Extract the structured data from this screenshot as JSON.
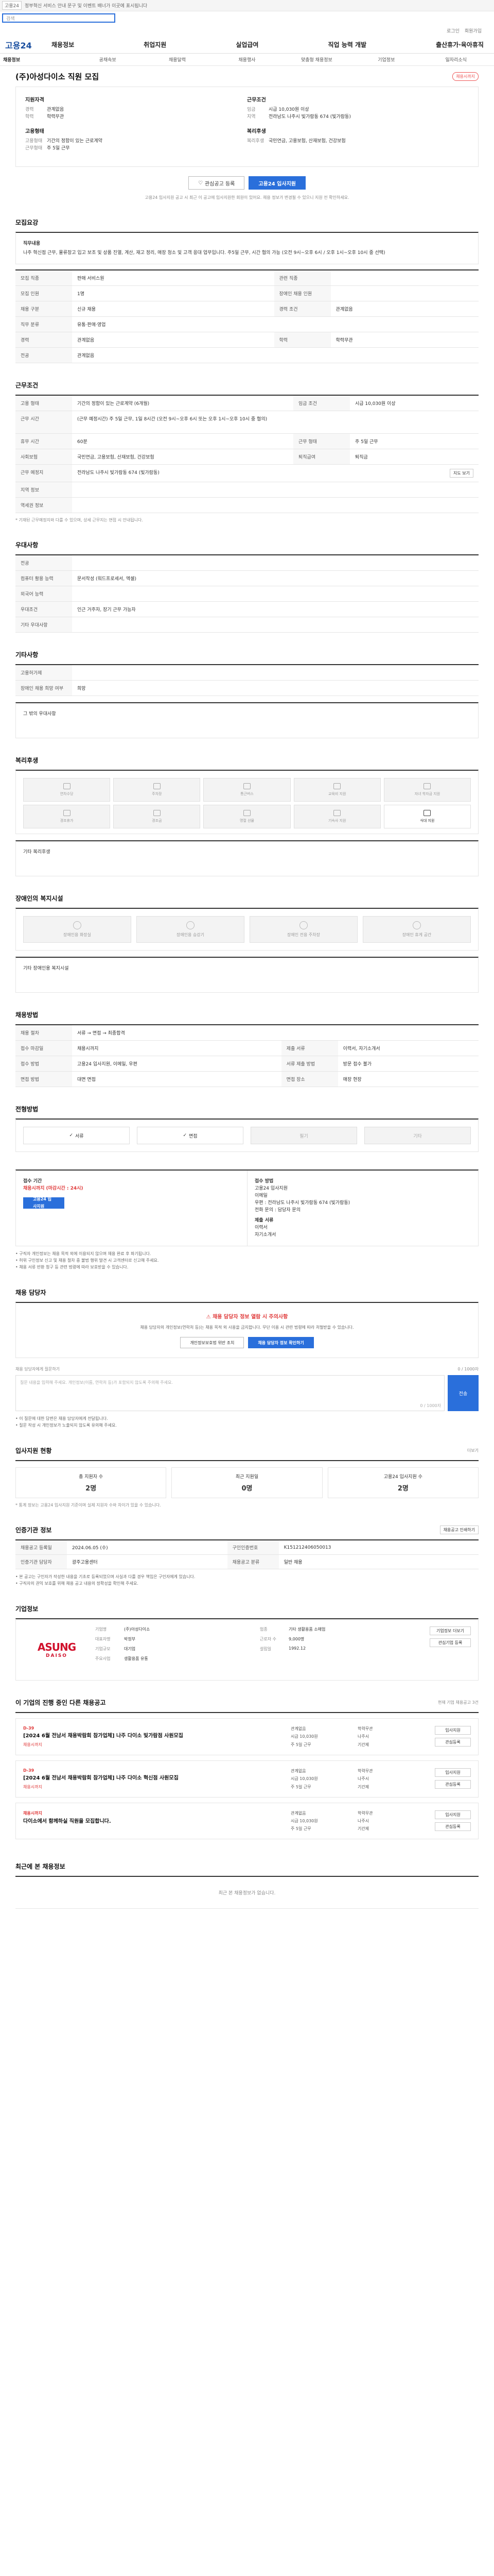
{
  "topbar": {
    "site_chip": "고용24",
    "notice": "정부혁신 서비스 안내 문구 및 이벤트 배너가 이곳에 표시됩니다"
  },
  "search": {
    "placeholder": "검색"
  },
  "util": {
    "login": "로그인",
    "join": "회원가입"
  },
  "gnb": {
    "logo": "고용24",
    "menu": [
      "채용정보",
      "취업지원",
      "실업급여",
      "직업 능력 개발",
      "출산휴가·육아휴직"
    ]
  },
  "lnb": [
    "채용정보",
    "공채속보",
    "채용달력",
    "채용행사",
    "맞춤형 채용정보",
    "기업정보",
    "일자리소식"
  ],
  "title": "(주)아성다이소 직원 모집",
  "title_badge": "채용시까지",
  "summary": {
    "left_title": "지원자격",
    "left_rows": [
      {
        "k": "경력",
        "v": "관계없음"
      },
      {
        "k": "학력",
        "v": "학력무관"
      }
    ],
    "right_title": "근무조건",
    "right_rows": [
      {
        "k": "임금",
        "v": "시급 10,030원 이상"
      },
      {
        "k": "지역",
        "v": "전라남도 나주시 빛가람동 674 (빛가람동)"
      }
    ],
    "left2_title": "고용형태",
    "left2_rows": [
      {
        "k": "고용형태",
        "v": "기간의 정함이 있는 근로계약"
      },
      {
        "k": "근무형태",
        "v": "주 5일 근무"
      }
    ],
    "right2_title": "복리후생",
    "right2_rows": [
      {
        "k": "복리후생",
        "v": "국민연금, 고용보험, 산재보험, 건강보험"
      }
    ]
  },
  "actions": {
    "interest": "관심공고 등록",
    "apply": "고용24 입사지원",
    "note": "고용24 입사지원 공고 시 최근 이 공고에 입사지원한 회원이 있어요. 채용 정보가 변경될 수 있으니 지원 전 확인하세요."
  },
  "recruit": {
    "title": "모집요강",
    "duty_label": "직무내용",
    "duty_text": "나주 혁신점 근무, 물류창고 입고 보조 및 상품 진열, 계산, 재고 정리, 매장 청소 및 고객 응대 업무입니다. 주5일 근무, 시간 협의 가능 (오전 9시~오후 6시 / 오후 1시~오후 10시 중 선택)",
    "rows": [
      {
        "k": "모집 직종",
        "v": "판매 서비스원",
        "k2": "관련 직종",
        "v2": ""
      },
      {
        "k": "모집 인원",
        "v": "1명",
        "k2": "장애인 채용 인원",
        "v2": ""
      },
      {
        "k": "채용 구분",
        "v": "신규 채용",
        "k2": "경력 조건",
        "v2": "관계없음"
      },
      {
        "k": "직무 분류",
        "v": "유통·판매·영업",
        "k2": "",
        "v2": ""
      },
      {
        "k": "경력",
        "v": "관계없음",
        "k2": "학력",
        "v2": "학력무관"
      },
      {
        "k": "전공",
        "v": "관계없음",
        "k2": "",
        "v2": ""
      }
    ]
  },
  "work": {
    "title": "근무조건",
    "rows": [
      {
        "k": "고용 형태",
        "v": "기간의 정함이 있는 근로계약 (6개월)",
        "k2": "임금 조건",
        "v2": "시급 10,030원 이상"
      },
      {
        "k": "근무 시간",
        "v": "(근무 예정시간) 주 5일 근무, 1일 8시간 (오전 9시~오후 6시 또는 오후 1시~오후 10시 중 협의)",
        "k2": "",
        "v2": ""
      },
      {
        "k": "휴무 시간",
        "v": "60분",
        "k2": "근무 형태",
        "v2": "주 5일 근무"
      },
      {
        "k": "사회보험",
        "v": "국민연금, 고용보험, 산재보험, 건강보험",
        "k2": "퇴직급여",
        "v2": "퇴직금"
      },
      {
        "k": "근무 예정지",
        "v": "전라남도 나주시 빛가람동 674 (빛가람동)",
        "k2": "",
        "v2": ""
      },
      {
        "k": "지역 정보",
        "v": "",
        "k2": "",
        "v2": ""
      },
      {
        "k": "역세권 정보",
        "v": "",
        "k2": "",
        "v2": ""
      }
    ],
    "map_button": "지도 보기",
    "note": "* 기재된 근무예정지와 다를 수 있으며, 상세 근무지는 면접 시 안내됩니다."
  },
  "prefer": {
    "title": "우대사항",
    "rows": [
      {
        "k": "전공",
        "v": ""
      },
      {
        "k": "컴퓨터 활용 능력",
        "v": "문서작성 (워드프로세서, 엑셀)"
      },
      {
        "k": "외국어 능력",
        "v": ""
      },
      {
        "k": "우대조건",
        "v": "인근 거주자, 장기 근무 가능자"
      },
      {
        "k": "기타 우대사항",
        "v": ""
      }
    ]
  },
  "etc": {
    "title": "기타사항",
    "rows": [
      {
        "k": "고용허가제",
        "v": ""
      },
      {
        "k": "장애인 채용 희망 여부",
        "v": "희망"
      }
    ]
  },
  "etc_text": {
    "label": "그 밖의 우대사항",
    "value": ""
  },
  "welfare": {
    "title": "복리후생",
    "items": [
      {
        "label": "연차수당",
        "on": false
      },
      {
        "label": "주차장",
        "on": false
      },
      {
        "label": "통근버스",
        "on": false
      },
      {
        "label": "교육비 지원",
        "on": false
      },
      {
        "label": "자녀 학자금 지원",
        "on": false
      },
      {
        "label": "경조휴가",
        "on": false
      },
      {
        "label": "경조금",
        "on": false
      },
      {
        "label": "명절 선물",
        "on": false
      },
      {
        "label": "기숙사 지원",
        "on": false
      },
      {
        "label": "식대 지원",
        "on": true
      }
    ],
    "other_label": "기타 복리후생",
    "other_value": ""
  },
  "disability": {
    "title": "장애인의 복지시설",
    "items": [
      "장애인용 화장실",
      "장애인용 승강기",
      "장애인 전용 주차장",
      "장애인 휴게 공간"
    ],
    "other_label": "기타 장애인용 복지시설",
    "other_value": ""
  },
  "process": {
    "title": "채용방법",
    "rows": [
      {
        "k": "채용 절차",
        "v": "서류 → 면접 → 최종합격",
        "k2": "",
        "v2": ""
      },
      {
        "k": "접수 마감일",
        "v": "채용시까지",
        "k2": "제출 서류",
        "v2": "이력서, 자기소개서"
      },
      {
        "k": "접수 방법",
        "v": "고용24 입사지원, 이메일, 우편",
        "k2": "서류 제출 방법",
        "v2": "방문 접수 불가"
      },
      {
        "k": "면접 방법",
        "v": "대면 면접",
        "k2": "면접 장소",
        "v2": "매장 현장"
      }
    ]
  },
  "selection": {
    "title": "전형방법",
    "steps": [
      {
        "label": "서류",
        "on": true
      },
      {
        "label": "면접",
        "on": true
      },
      {
        "label": "필기",
        "on": false
      },
      {
        "label": "기타",
        "on": false
      }
    ]
  },
  "apply": {
    "left_title": "접수 기간",
    "left_red": "채용시까지 (마감시간 : 24시)",
    "left_btn": "고용24 입사지원",
    "right_title": "접수 방법",
    "right_lines": [
      "고용24 입사지원",
      "이메일",
      "우편 : 전라남도 나주시 빛가람동 674 (빛가람동)",
      "전화 문의 : 담당자 문의"
    ],
    "right_title2": "제출 서류",
    "right_lines2": [
      "이력서",
      "자기소개서"
    ],
    "bullets": [
      "• 구직자 개인정보는 채용 목적 외에 이용되지 않으며 채용 완료 후 파기됩니다.",
      "• 허위 구인정보 신고 및 채용 절차 중 불법 행위 발견 시 고객센터로 신고해 주세요.",
      "• 채용 서류 반환 청구 등 관련 법령에 따라 보호받을 수 있습니다."
    ]
  },
  "contact": {
    "title": "채용 담당자",
    "red": "채용 담당자 정보 열람 시 주의사항",
    "desc": "채용 담당자의 개인정보(연락처 등)는 채용 목적 외 사용을 금지합니다. 무단 이용 시 관련 법령에 따라 처벌받을 수 있습니다.",
    "btn1": "개인정보보호법 위반 조치",
    "btn2": "채용 담당자 정보 확인하기",
    "qa_left": "채용 담당자에게 질문하기",
    "qa_right": "0 / 1000자",
    "qa_placeholder": "질문 내용을 입력해 주세요. 개인정보(이름, 연락처 등)가 포함되지 않도록 주의해 주세요.",
    "qa_submit": "전송",
    "qa_notes": [
      "• 이 질문에 대한 답변은 채용 담당자에게 전달됩니다.",
      "• 질문 작성 시 개인정보가 노출되지 않도록 유의해 주세요."
    ]
  },
  "stats": {
    "title": "입사지원 현황",
    "more": "더보기",
    "items": [
      {
        "label": "총 지원자 수",
        "value": "2명"
      },
      {
        "label": "최근 지원일",
        "value": "0명"
      },
      {
        "label": "고용24 입사지원 수",
        "value": "2명"
      }
    ],
    "note": "* 통계 정보는 고용24 입사지원 기준이며 실제 지원자 수와 차이가 있을 수 있습니다."
  },
  "info": {
    "title": "인증기관 정보",
    "btn": "채용공고 인쇄하기",
    "rows": [
      {
        "k": "채용공고 등록일",
        "v": "2024.06.05 (수)",
        "k2": "구인인증번호",
        "v2": "K151212406050013"
      },
      {
        "k": "인증기관 담당자",
        "v": "광주고용센터",
        "k2": "채용공고 분류",
        "v2": "일반 채용"
      }
    ],
    "bullets": [
      "• 본 공고는 구인자가 작성한 내용을 기초로 등록되었으며 사실과 다를 경우 책임은 구인자에게 있습니다.",
      "• 구직자의 권익 보호를 위해 채용 공고 내용의 정확성을 확인해 주세요."
    ]
  },
  "company": {
    "title": "기업정보",
    "logo_main": "ASUNG",
    "logo_sub": "DAISO",
    "rows": [
      {
        "k": "기업명",
        "v": "(주)아성다이소",
        "k2": "업종",
        "v2": "기타 생활용품 소매업"
      },
      {
        "k": "대표자명",
        "v": "박정부",
        "k2": "근로자 수",
        "v2": "9,000명"
      },
      {
        "k": "기업규모",
        "v": "대기업",
        "k2": "설립일",
        "v2": "1992.12"
      },
      {
        "k": "주요사업",
        "v": "생활용품 유통"
      }
    ],
    "btn1": "기업정보 더보기",
    "btn2": "관심기업 등록"
  },
  "others": {
    "title": "이 기업의 진행 중인 다른 채용공고",
    "note": "현재 기업 채용공고 3건",
    "jobs": [
      {
        "d": "D-39",
        "title": "[2024 6월 전남서 채용박람회 참가업체] 나주 다이소 빛가람점 사원모집",
        "c": "채용시까지",
        "m": [
          "관계없음",
          "학력무관",
          "시급 10,030원",
          "나주시",
          "주 5일 근무",
          "기간제"
        ],
        "b1": "입사지원",
        "b2": "관심등록"
      },
      {
        "d": "D-39",
        "title": "[2024 6월 전남서 채용박람회 참가업체] 나주 다이소 혁신점 사원모집",
        "c": "채용시까지",
        "m": [
          "관계없음",
          "학력무관",
          "시급 10,030원",
          "나주시",
          "주 5일 근무",
          "기간제"
        ],
        "b1": "입사지원",
        "b2": "관심등록"
      },
      {
        "d": "채용시까지",
        "title": "다이소에서 함께하실 직원을 모집합니다.",
        "c": "",
        "m": [
          "관계없음",
          "학력무관",
          "시급 10,030원",
          "나주시",
          "주 5일 근무",
          "기간제"
        ],
        "b1": "입사지원",
        "b2": "관심등록"
      }
    ]
  },
  "recent": {
    "title": "최근에 본 채용정보",
    "empty": "최근 본 채용정보가 없습니다."
  }
}
